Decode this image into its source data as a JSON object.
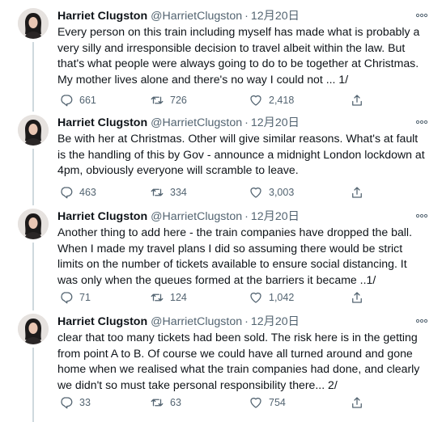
{
  "author": {
    "name": "Harriet Clugston",
    "handle": "@HarrietClugston",
    "separator": "·"
  },
  "icons": {
    "reply": "reply-icon",
    "retweet": "retweet-icon",
    "like": "heart-icon",
    "share": "share-icon",
    "more": "more-options-icon"
  },
  "colors": {
    "text": "#0f1419",
    "muted": "#536471",
    "thread_line": "#cfd9de"
  },
  "tweets": [
    {
      "date": "12月20日",
      "lines": [
        "Every person on this train including myself has made what is probably a",
        "very silly and irresponsible decision to travel albeit within the law. But",
        "that's what people were always going to do to be together at Christmas.",
        "My mother lives alone and there's no way I could not ... 1/"
      ],
      "replies": "661",
      "retweets": "726",
      "likes": "2,418"
    },
    {
      "date": "12月20日",
      "lines": [
        "Be with her at Christmas. Other will give similar reasons. What's at fault",
        "is the handling of this by Gov - announce a midnight London lockdown at",
        "4pm, obviously everyone will scramble to leave."
      ],
      "replies": "463",
      "retweets": "334",
      "likes": "3,003"
    },
    {
      "date": "12月20日",
      "lines": [
        "Another thing to add here - the train companies have dropped the ball.",
        "When I made my travel plans I did so assuming there would be strict",
        "limits on the number of tickets available to ensure social distancing. It",
        "was only when the queues formed at the barriers it became ..1/"
      ],
      "replies": "71",
      "retweets": "124",
      "likes": "1,042"
    },
    {
      "date": "12月20日",
      "lines": [
        "clear that too many tickets had been sold. The risk here is in the getting",
        "from point A to B. Of course we could have all turned around and gone",
        "home when we realised what the train companies had done, and clearly",
        "we didn't so must take personal responsibility there... 2/"
      ],
      "replies": "33",
      "retweets": "63",
      "likes": "754"
    }
  ]
}
